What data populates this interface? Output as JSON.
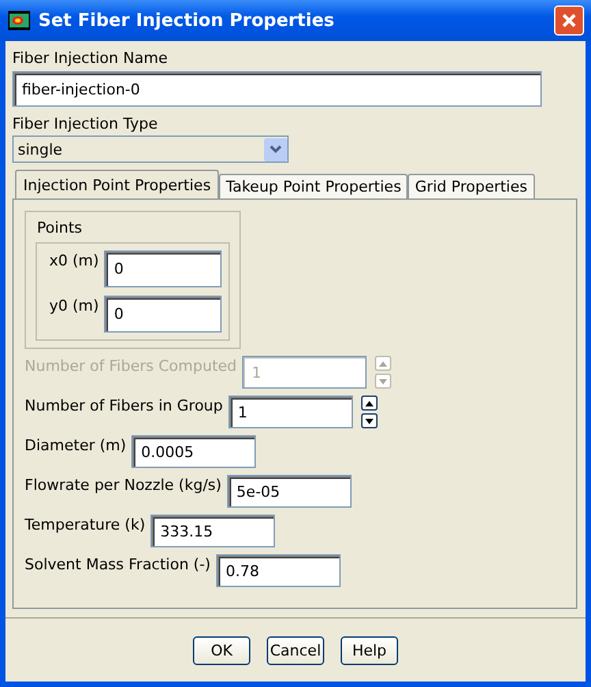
{
  "window": {
    "title": "Set Fiber Injection Properties"
  },
  "name_field": {
    "label": "Fiber Injection Name",
    "value": "fiber-injection-0"
  },
  "type_dropdown": {
    "label": "Fiber Injection Type",
    "value": "single"
  },
  "tabs": [
    {
      "label": "Injection Point Properties",
      "selected": true
    },
    {
      "label": "Takeup Point Properties",
      "selected": false
    },
    {
      "label": "Grid Properties",
      "selected": false
    }
  ],
  "points": {
    "title": "Points",
    "fields": [
      {
        "label": "x0 (m)",
        "value": "0"
      },
      {
        "label": "y0 (m)",
        "value": "0"
      }
    ]
  },
  "properties": [
    {
      "kind": "spin",
      "label": "Number of Fibers Computed",
      "value": "1",
      "disabled": true
    },
    {
      "kind": "spin",
      "label": "Number of Fibers in Group",
      "value": "1",
      "disabled": false
    },
    {
      "kind": "text",
      "label": "Diameter (m)",
      "value": "0.0005",
      "disabled": false
    },
    {
      "kind": "text",
      "label": "Flowrate per Nozzle (kg/s)",
      "value": "5e-05",
      "disabled": false
    },
    {
      "kind": "text",
      "label": "Temperature (k)",
      "value": "333.15",
      "disabled": false
    },
    {
      "kind": "text",
      "label": "Solvent Mass Fraction (-)",
      "value": "0.78",
      "disabled": false
    }
  ],
  "buttons": [
    "OK",
    "Cancel",
    "Help"
  ]
}
